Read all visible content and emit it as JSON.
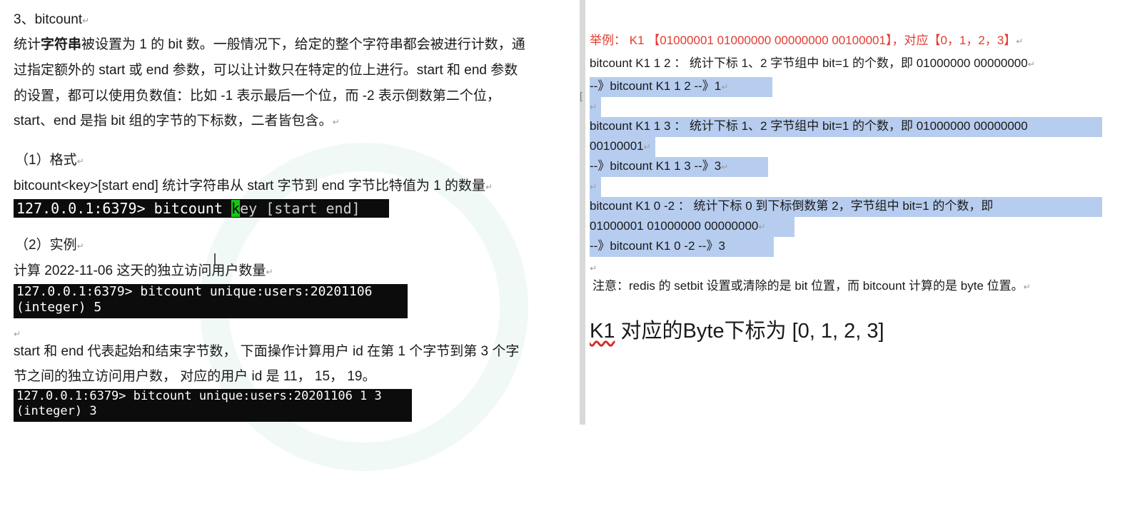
{
  "left": {
    "heading": "3、bitcount",
    "desc_line1_pre": "统计",
    "desc_line1_bold": "字符串",
    "desc_line1_post": "被设置为 1 的 bit 数。一般情况下，给定的整个字符串都会被进行计数，通",
    "desc_line2": "过指定额外的 start 或 end 参数，可以让计数只在特定的位上进行。start 和 end 参数",
    "desc_line3": "的设置，都可以使用负数值：比如 -1 表示最后一个位，而 -2 表示倒数第二个位，",
    "desc_line4": "start、end 是指 bit 组的字节的下标数，二者皆包含。",
    "format_heading": "（1）格式",
    "format_desc": "bitcount<key>[start end] 统计字符串从 start 字节到 end 字节比特值为 1 的数量",
    "cmd1_prompt": "127.0.0.1:6379> bitcount ",
    "cmd1_key_first": "k",
    "cmd1_rest": "ey [start end]",
    "example_heading": "（2）实例",
    "example_desc": "计算 2022-11-06 这天的独立访问用户数量",
    "cmd2_line1": "127.0.0.1:6379> bitcount unique:users:20201106",
    "cmd2_line2": "(integer) 5",
    "range_line1": "start 和 end 代表起始和结束字节数， 下面操作计算用户 id 在第 1 个字节到第 3 个字",
    "range_line2": "节之间的独立访问用户数， 对应的用户 id 是 11， 15， 19。",
    "cmd3_line1": "127.0.0.1:6379> bitcount unique:users:20201106 1 3",
    "cmd3_line2": "(integer) 3",
    "para_mark": "↵"
  },
  "right": {
    "example_line": "举例： K1 【01000001 01000000  00000000 00100001】，对应【0，1，2，3】",
    "l1": "bitcount K1 1 2   ：  统计下标 1、2 字节组中 bit=1 的个数，即 01000000   00000000",
    "l2": "--》bitcount K1 1 2       --》1",
    "l3": "bitcount  K1  1  3    ：  统计下标 1、2 字节组中 bit=1 的个数，即 01000000    00000000",
    "l4": "00100001",
    "l5": "--》bitcount  K1 1 3       --》3",
    "l6": "bitcount  K1  0  -2    ：  统计下标  0  到下标倒数第  2，字节组中  bit=1  的个数，即",
    "l7": "01000001  01000000    00000000",
    "l8": "--》bitcount  K1 0 -2       --》3",
    "note": "注意：redis 的 setbit 设置或清除的是 bit 位置，而 bitcount 计算的是 byte 位置。",
    "k1_word": "K1",
    "k1_rest": " 对应的Byte下标为 [0, 1, 2, 3]",
    "para_mark": "↵"
  },
  "colors": {
    "selection": "#b7cdef",
    "red": "#e23b2f",
    "terminal": "#0c0c0c"
  }
}
